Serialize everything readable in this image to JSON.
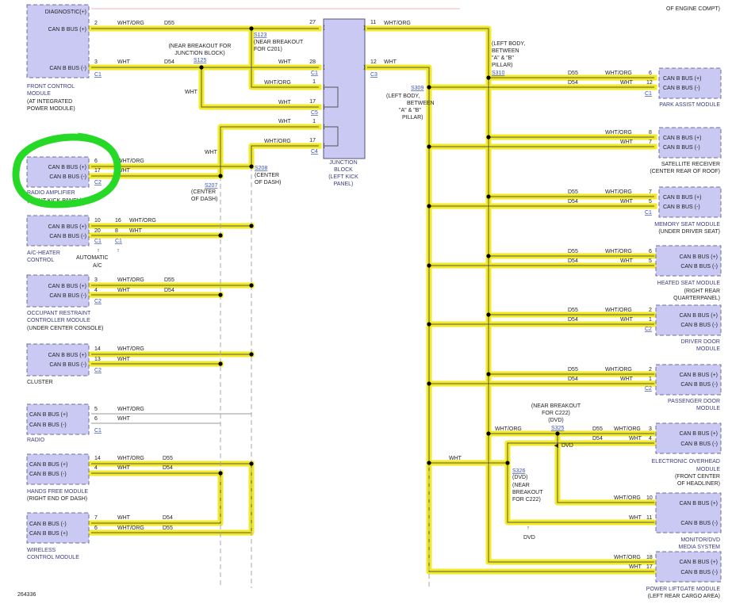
{
  "figure_id": "264336",
  "labels": {
    "wht": "WHT",
    "wht_org": "WHT/ORG",
    "d55": "D55",
    "d54": "D54",
    "bus_pos": "CAN B BUS (+)",
    "bus_neg": "CAN B BUS (-)",
    "diag": "DIAGNOSTIC(+)",
    "dvd": "DVD"
  },
  "modules": {
    "front_control": [
      "FRONT CONTROL",
      "MODULE",
      "(AT INTEGRATED",
      "POWER MODULE)"
    ],
    "radio_amp": [
      "RADIO AMPLIFIER",
      "(RIGHT KICK PANEL)"
    ],
    "ac_heater": [
      "A/C-HEATER",
      "CONTROL"
    ],
    "ac_variants": [
      "AUTOMATIC",
      "A/C"
    ],
    "occupant": [
      "OCCUPANT RESTRAINT",
      "CONTROLLER MODULE",
      "(UNDER CENTER CONSOLE)"
    ],
    "cluster": [
      "CLUSTER"
    ],
    "radio": [
      "RADIO"
    ],
    "hands_free": [
      "HANDS FREE MODULE",
      "(RIGHT END OF DASH)"
    ],
    "wireless": [
      "WIRELESS",
      "CONTROL MODULE"
    ],
    "junction": [
      "JUNCTION",
      "BLOCK",
      "(LEFT KICK",
      "PANEL)"
    ],
    "top_right": "OF ENGINE COMPT)",
    "park_assist": [
      "PARK ASSIST MODULE"
    ],
    "satellite": [
      "SATELLITE RECEIVER",
      "(CENTER REAR OF ROOF)"
    ],
    "memory_seat": [
      "MEMORY SEAT MODULE",
      "(UNDER DRIVER SEAT)"
    ],
    "heated_seat": [
      "HEATED SEAT MODULE",
      "(RIGHT REAR",
      "QUARTERPANEL)"
    ],
    "driver_door": [
      "DRIVER DOOR",
      "MODULE"
    ],
    "passenger_door": [
      "PASSENGER DOOR",
      "MODULE"
    ],
    "overhead": [
      "ELECTRONIC OVERHEAD",
      "MODULE",
      "(FRONT CENTER",
      "OF HEADLINER)"
    ],
    "monitor_dvd": [
      "MONITOR/DVD",
      "MEDIA SYSTEM"
    ],
    "liftgate": [
      "POWER LIFTGATE MODULE",
      "(LEFT REAR CARGO AREA)"
    ]
  },
  "splices": {
    "s123": [
      "S123",
      "(NEAR BREAKOUT",
      "FOR C201)"
    ],
    "s125": [
      "S125"
    ],
    "near_jb": [
      "(NEAR BREAKOUT FOR",
      "JUNCTION BLOCK)"
    ],
    "s207": [
      "S207",
      "(CENTER",
      "OF DASH)"
    ],
    "s208": [
      "S208",
      "(CENTER",
      "OF DASH)"
    ],
    "s309": [
      "S309",
      "(LEFT BODY,",
      "BETWEEN",
      "\"A\" & \"B\"",
      "PILLAR)"
    ],
    "s310": [
      "(LEFT BODY,",
      "BETWEEN",
      "\"A\" & \"B\"",
      "PILLAR)",
      "S310"
    ],
    "s325": [
      "(NEAR BREAKOUT",
      "FOR C222)",
      "(DVD)",
      "S325"
    ],
    "s326": [
      "S326",
      "(DVD)",
      "(NEAR",
      "BREAKOUT",
      "FOR C222)"
    ]
  },
  "connectors": {
    "c1": "C1",
    "c2": "C2",
    "c3": "C3",
    "c4": "C4",
    "c5": "C5"
  },
  "pins": {
    "fc_2": "2",
    "fc_3": "3",
    "jb_27": "27",
    "jb_28": "28",
    "jb_1": "1",
    "jb_17a": "17",
    "jb_1b": "1",
    "jb_17b": "17",
    "jb_11": "11",
    "jb_12": "12",
    "ra_6": "6",
    "ra_17": "17",
    "ac_10": "10",
    "ac_20": "20",
    "ac_16": "16",
    "ac_8": "8",
    "oc_3": "3",
    "oc_4": "4",
    "cl_14": "14",
    "cl_13": "13",
    "rd_5": "5",
    "rd_6": "6",
    "hf_14": "14",
    "hf_4": "4",
    "wc_7": "7",
    "wc_6": "6",
    "pa_6": "6",
    "pa_12": "12",
    "sr_8": "8",
    "sr_7": "7",
    "ms_7": "7",
    "ms_5": "5",
    "hs_6": "6",
    "hs_5": "5",
    "dd_2": "2",
    "dd_1": "1",
    "pd_2": "2",
    "pd_1": "1",
    "eo_3": "3",
    "eo_4": "4",
    "mv_10": "10",
    "mv_11": "11",
    "pl_18": "18",
    "pl_17": "17"
  },
  "highlight_color": "#f2ea22",
  "annotation_circle_color": "#26d926"
}
